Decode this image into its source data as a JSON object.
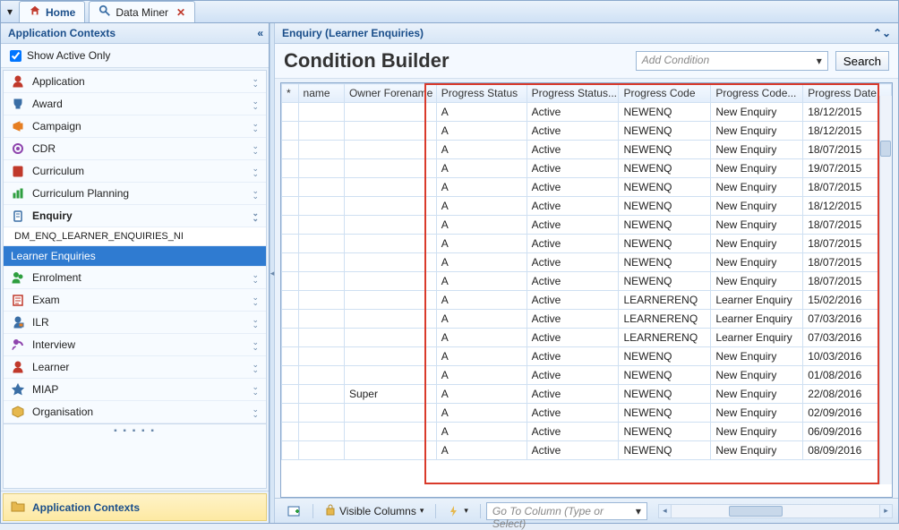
{
  "tabs": {
    "home": "Home",
    "dataMiner": "Data Miner"
  },
  "sidebar": {
    "title": "Application Contexts",
    "showActive": "Show Active Only",
    "items": [
      {
        "label": "Application"
      },
      {
        "label": "Award"
      },
      {
        "label": "Campaign"
      },
      {
        "label": "CDR"
      },
      {
        "label": "Curriculum"
      },
      {
        "label": "Curriculum Planning"
      },
      {
        "label": "Enquiry",
        "bold": true,
        "sub": "DM_ENQ_LEARNER_ENQUIRIES_NI",
        "selectedSub": "Learner Enquiries"
      },
      {
        "label": "Enrolment"
      },
      {
        "label": "Exam"
      },
      {
        "label": "ILR"
      },
      {
        "label": "Interview"
      },
      {
        "label": "Learner"
      },
      {
        "label": "MIAP"
      },
      {
        "label": "Organisation"
      }
    ],
    "footer": "Application Contexts"
  },
  "main": {
    "header": "Enquiry (Learner Enquiries)",
    "title": "Condition Builder",
    "addCondition": "Add Condition",
    "search": "Search"
  },
  "grid": {
    "columns": [
      "*",
      "name",
      "Owner Forename",
      "Progress Status",
      "Progress Status...",
      "Progress Code",
      "Progress Code...",
      "Progress Date"
    ],
    "rows": [
      [
        "",
        "",
        "",
        "A",
        "Active",
        "NEWENQ",
        "New Enquiry",
        "18/12/2015"
      ],
      [
        "",
        "",
        "",
        "A",
        "Active",
        "NEWENQ",
        "New Enquiry",
        "18/12/2015"
      ],
      [
        "",
        "",
        "",
        "A",
        "Active",
        "NEWENQ",
        "New Enquiry",
        "18/07/2015"
      ],
      [
        "",
        "",
        "",
        "A",
        "Active",
        "NEWENQ",
        "New Enquiry",
        "19/07/2015"
      ],
      [
        "",
        "",
        "",
        "A",
        "Active",
        "NEWENQ",
        "New Enquiry",
        "18/07/2015"
      ],
      [
        "",
        "",
        "",
        "A",
        "Active",
        "NEWENQ",
        "New Enquiry",
        "18/12/2015"
      ],
      [
        "",
        "",
        "",
        "A",
        "Active",
        "NEWENQ",
        "New Enquiry",
        "18/07/2015"
      ],
      [
        "",
        "",
        "",
        "A",
        "Active",
        "NEWENQ",
        "New Enquiry",
        "18/07/2015"
      ],
      [
        "",
        "",
        "",
        "A",
        "Active",
        "NEWENQ",
        "New Enquiry",
        "18/07/2015"
      ],
      [
        "",
        "",
        "",
        "A",
        "Active",
        "NEWENQ",
        "New Enquiry",
        "18/07/2015"
      ],
      [
        "",
        "",
        "",
        "A",
        "Active",
        "LEARNERENQ",
        "Learner Enquiry",
        "15/02/2016"
      ],
      [
        "",
        "",
        "",
        "A",
        "Active",
        "LEARNERENQ",
        "Learner Enquiry",
        "07/03/2016"
      ],
      [
        "",
        "",
        "",
        "A",
        "Active",
        "LEARNERENQ",
        "Learner Enquiry",
        "07/03/2016"
      ],
      [
        "",
        "",
        "",
        "A",
        "Active",
        "NEWENQ",
        "New Enquiry",
        "10/03/2016"
      ],
      [
        "",
        "",
        "",
        "A",
        "Active",
        "NEWENQ",
        "New Enquiry",
        "01/08/2016"
      ],
      [
        "",
        "",
        "Super",
        "A",
        "Active",
        "NEWENQ",
        "New Enquiry",
        "22/08/2016"
      ],
      [
        "",
        "",
        "",
        "A",
        "Active",
        "NEWENQ",
        "New Enquiry",
        "02/09/2016"
      ],
      [
        "",
        "",
        "",
        "A",
        "Active",
        "NEWENQ",
        "New Enquiry",
        "06/09/2016"
      ],
      [
        "",
        "",
        "",
        "A",
        "Active",
        "NEWENQ",
        "New Enquiry",
        "08/09/2016"
      ]
    ]
  },
  "status": {
    "visibleColumns": "Visible Columns",
    "goto": "Go To Column (Type or Select)"
  },
  "icons": {
    "home": "🏠",
    "dm": "🔍",
    "close": "✕",
    "app": "👤",
    "award": "🏆",
    "campaign": "📢",
    "cdr": "⚙",
    "curr": "📕",
    "plan": "📊",
    "enq": "📄",
    "enrol": "👥",
    "exam": "📝",
    "ilr": "👨‍💼",
    "interview": "🗣",
    "learner": "👤",
    "miap": "✳",
    "org": "📦",
    "folder": "🗂",
    "lock": "🔒",
    "bolt": "⚡",
    "new": "➕"
  }
}
